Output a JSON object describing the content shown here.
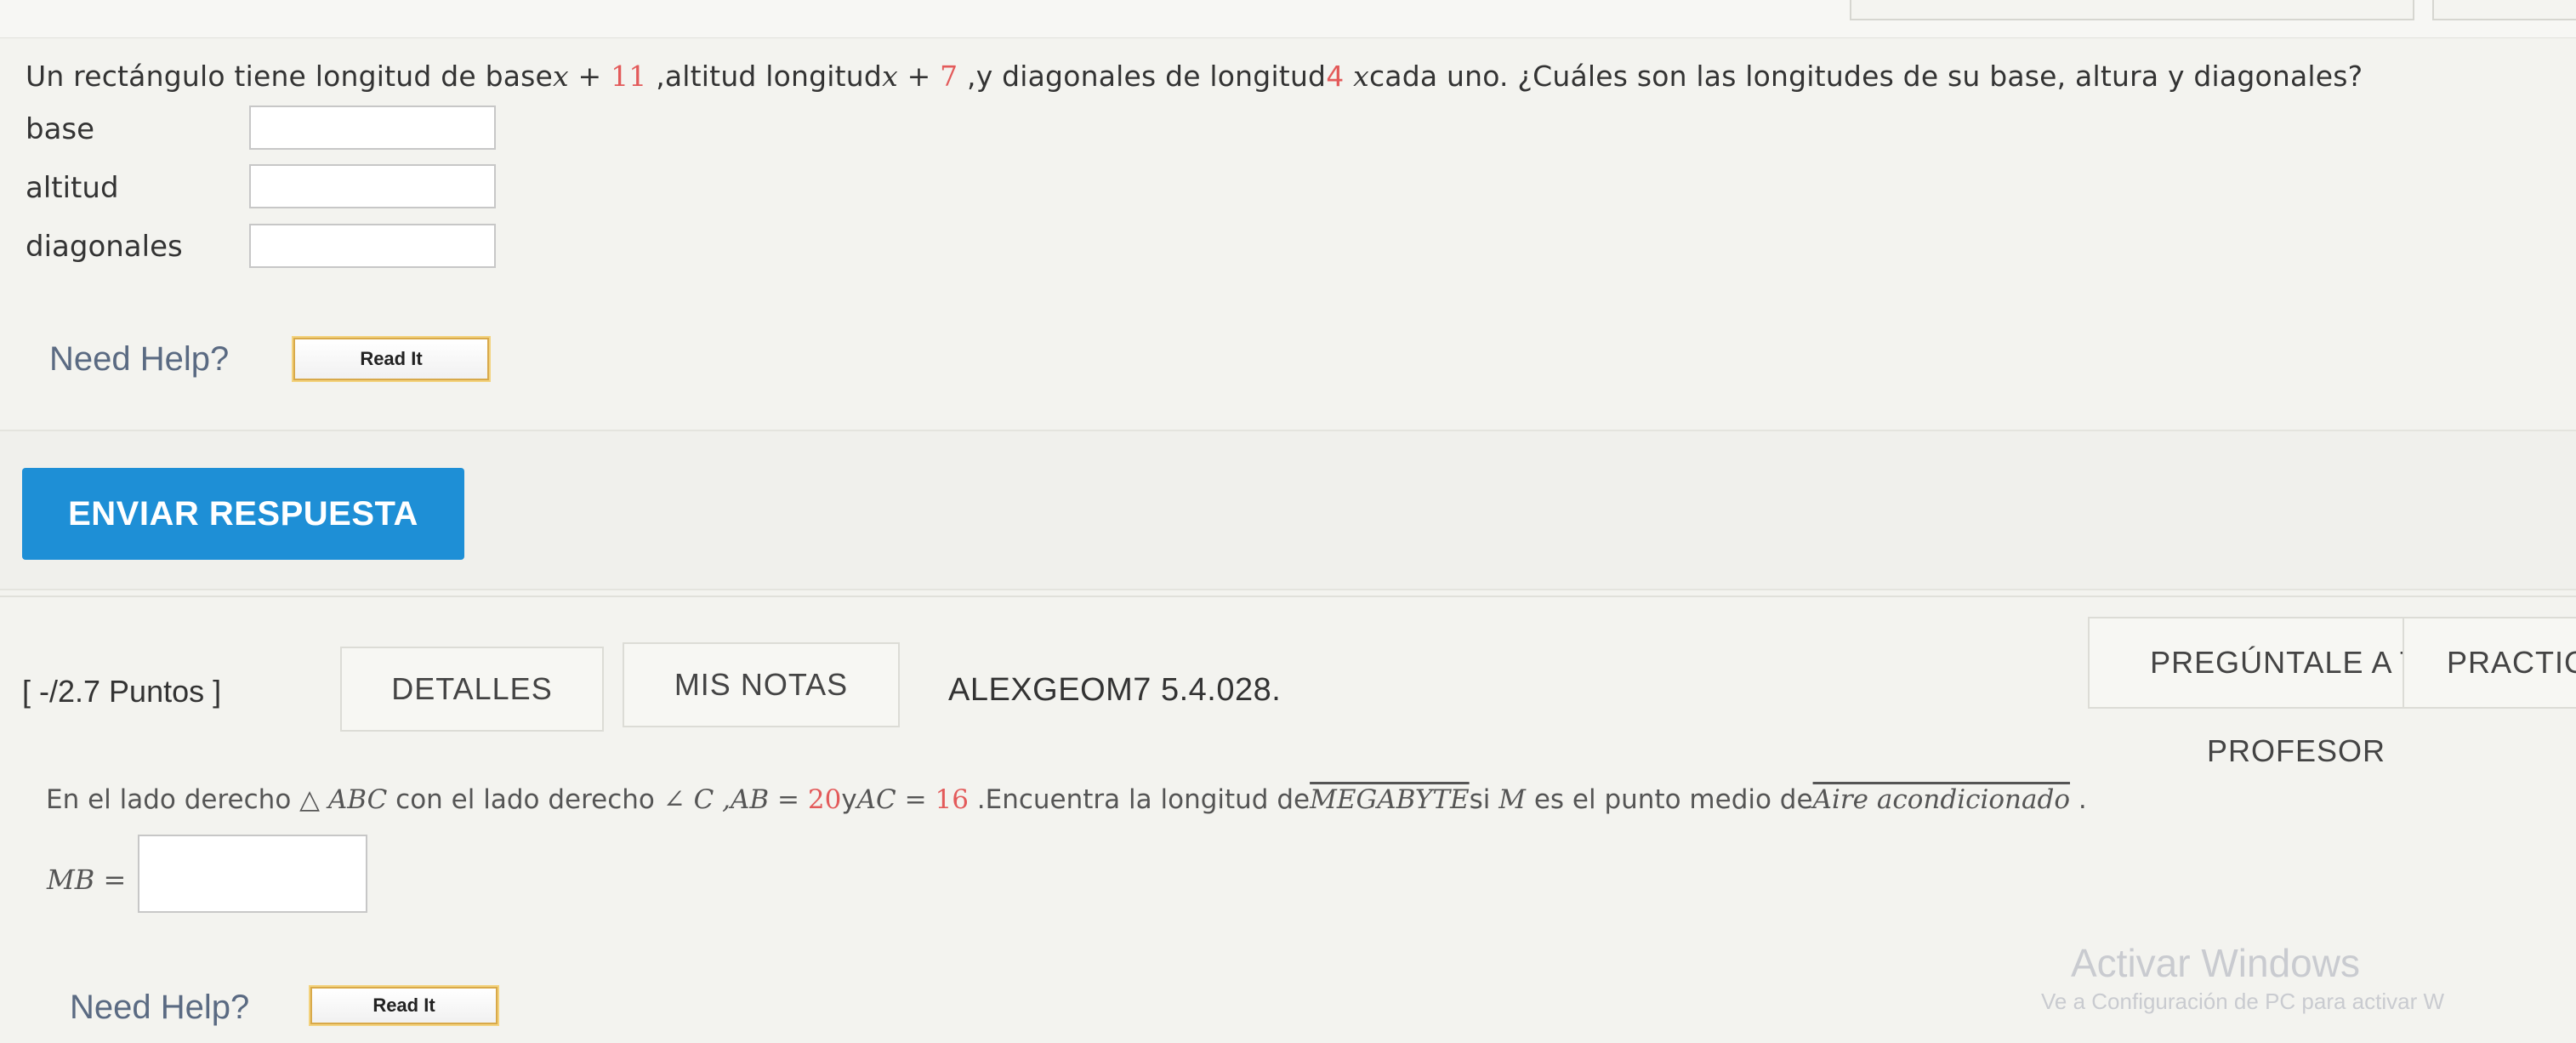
{
  "question1": {
    "text_pre": "Un rectángulo tiene longitud de base",
    "expr_base_var": "x + ",
    "expr_base_num": "11",
    "text_mid1": " ,altitud longitud",
    "expr_alt_var": "x + ",
    "expr_alt_num": "7",
    "text_mid2": " ,y diagonales de longitud",
    "expr_diag_num": "4",
    "expr_diag_var": " x",
    "text_post": "cada uno. ¿Cuáles son las longitudes de su base, altura y diagonales?",
    "fields": [
      {
        "label": "base",
        "value": ""
      },
      {
        "label": "altitud",
        "value": ""
      },
      {
        "label": "diagonales",
        "value": ""
      }
    ],
    "need_help": "Need Help?",
    "read_it": "Read It"
  },
  "submit": {
    "label": "ENVIAR RESPUESTA"
  },
  "question2": {
    "points": "[ -/2.7 Puntos ]",
    "details_tab": "DETALLES",
    "notes_tab": "MIS NOTAS",
    "code": "ALEXGEOM7 5.4.028.",
    "ask_teacher": "PREGÚNTALE A TU PROFESOR",
    "practice": "PRACTICA",
    "text_pre": "En el lado derecho ",
    "triangle": "△ ABC",
    "text_mid1": " con el lado derecho ",
    "angle": "∠ C",
    "ab_expr": " ,AB = ",
    "ab_val": "20",
    "y_word": "y",
    "ac_expr": "AC = ",
    "ac_val": "16",
    "text_mid2": " .Encuentra la longitud de",
    "segment": "MEGABYTE",
    "text_mid3": "si ",
    "m_var": "M",
    "text_mid4": " es el punto medio de",
    "segment2": "Aire acondicionado",
    "text_end": " .",
    "mb_label": "MB =",
    "mb_value": "",
    "need_help": "Need Help?",
    "read_it": "Read It"
  },
  "watermark": {
    "line1": "Activar Windows",
    "line2": "Ve a Configuración de PC para activar W"
  }
}
